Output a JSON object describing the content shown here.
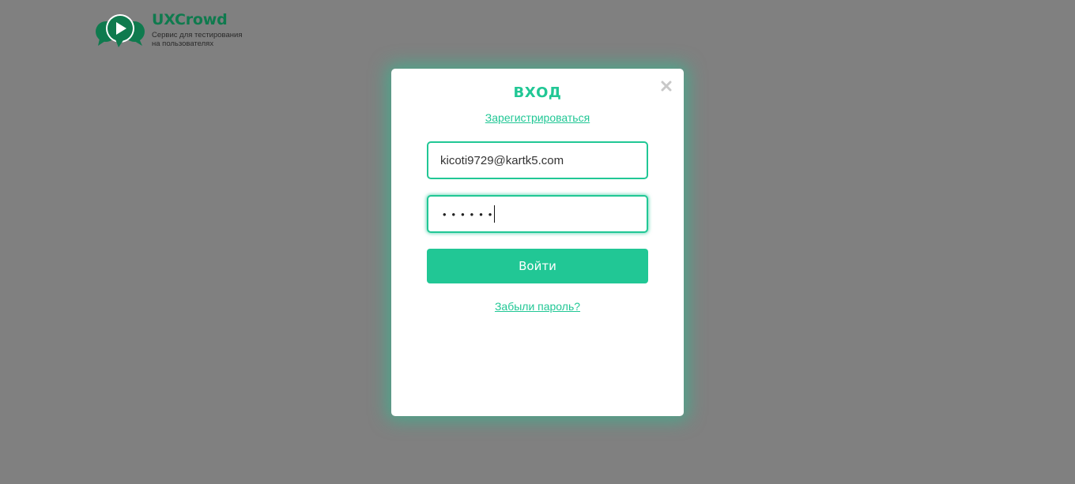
{
  "logo": {
    "name": "UXCrowd",
    "tagline": "Сервис для тестирования на пользователях",
    "icon": "chat-bubbles-play-icon",
    "color": "#0f7a4e"
  },
  "modal": {
    "title": "ВХОД",
    "register_link": "Зарегистрироваться",
    "email_value": "kicoti9729@kartk5.com",
    "password_mask": "••••••",
    "login_button": "Войти",
    "forgot_link": "Забыли пароль?",
    "close_icon": "close-icon",
    "accent_color": "#21c795"
  }
}
